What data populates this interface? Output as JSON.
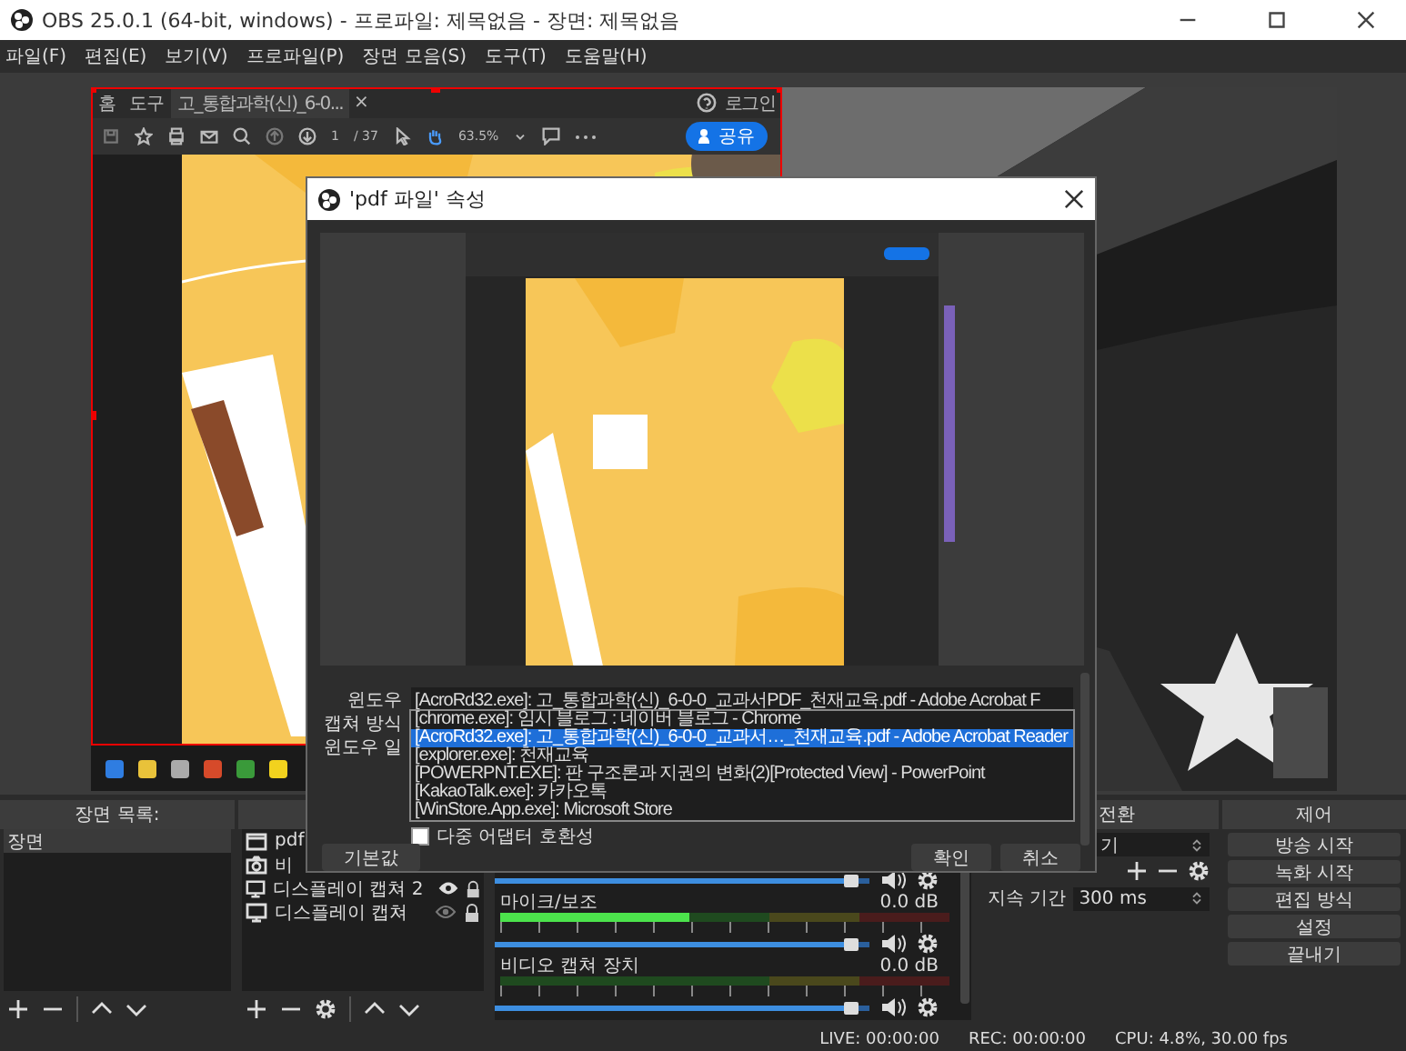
{
  "window": {
    "title": "OBS 25.0.1 (64-bit, windows) - 프로파일: 제목없음 - 장면: 제목없음"
  },
  "menu": [
    "파일(F)",
    "편집(E)",
    "보기(V)",
    "프로파일(P)",
    "장면 모음(S)",
    "도구(T)",
    "도움말(H)"
  ],
  "preview": {
    "capture": {
      "tabs": [
        {
          "label": "홈",
          "selected": false
        },
        {
          "label": "도구",
          "selected": false
        },
        {
          "label": "고_통합과학(신)_6-0...",
          "selected": true
        }
      ],
      "tab_close": "×",
      "login": "로그인",
      "page": "1",
      "page_total": "/ 37",
      "zoom": "63.5%",
      "share": "공유"
    }
  },
  "dialog": {
    "title": "'pdf 파일' 속성",
    "fields": [
      {
        "label": "윈도우",
        "value": "[AcroRd32.exe]: 고_통합과학(신)_6-0-0_교과서PDF_천재교육.pdf - Adobe Acrobat F"
      },
      {
        "label": "캡쳐 방식"
      },
      {
        "label": "윈도우 일"
      }
    ],
    "window_options": [
      {
        "label": "[chrome.exe]: 임시 블로그 : 네이버 블로그 - Chrome",
        "selected": false
      },
      {
        "label": "[AcroRd32.exe]: 고_통합과학(신)_6-0-0_교과서…_천재교육.pdf - Adobe Acrobat Reader",
        "selected": true
      },
      {
        "label": "[explorer.exe]: 천재교육",
        "selected": false
      },
      {
        "label": "[POWERPNT.EXE]: 판 구조론과 지권의 변화(2)[Protected View] - PowerPoint",
        "selected": false
      },
      {
        "label": "[KakaoTalk.exe]: 카카오톡",
        "selected": false
      },
      {
        "label": "[WinStore.App.exe]: Microsoft Store",
        "selected": false
      }
    ],
    "checkbox": {
      "label": "다중 어댑터 호환성",
      "checked": false
    },
    "defaults_button": "기본값",
    "ok_button": "확인",
    "cancel_button": "취소"
  },
  "scenes": {
    "title": "장면 목록:",
    "items": [
      {
        "name": "장면",
        "selected": true
      }
    ]
  },
  "sources": {
    "items": [
      {
        "name": "pdf",
        "kind": "window"
      },
      {
        "name": "비",
        "kind": "camera"
      },
      {
        "name": "디스플레이 캡쳐 2",
        "kind": "display",
        "visible": true
      },
      {
        "name": "디스플레이 캡쳐",
        "kind": "display",
        "visible": false
      }
    ]
  },
  "mixer": {
    "tracks": [
      {
        "fader": {
          "level": 0.97
        }
      },
      {
        "name": "마이크/보조",
        "reading": "0.0 dB",
        "meter": {
          "level": 0.42
        },
        "fader": {
          "level": 0.97
        }
      },
      {
        "name": "비디오 캡쳐 장치",
        "reading": "0.0 dB",
        "fader": {
          "level": 0.97
        }
      }
    ]
  },
  "transitions": {
    "title": "전환",
    "combo": "기",
    "duration_label": "지속 기간",
    "duration": "300 ms"
  },
  "controls": {
    "title": "제어",
    "buttons": [
      "방송 시작",
      "녹화 시작",
      "편집 방식",
      "설정",
      "끝내기"
    ]
  },
  "status": [
    "LIVE: 00:00:00",
    "REC: 00:00:00",
    "CPU: 4.8%, 30.00 fps"
  ]
}
